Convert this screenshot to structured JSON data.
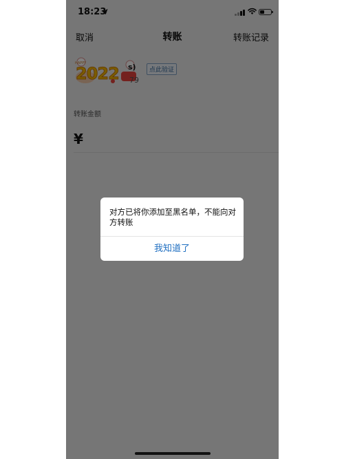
{
  "status_bar": {
    "time": "18:23"
  },
  "nav": {
    "cancel_label": "取消",
    "title": "转账",
    "records_label": "转账记录"
  },
  "recipient": {
    "name_suffix": "s)",
    "verify_label": "点此验证",
    "account_suffix": "79"
  },
  "amount": {
    "label": "转账金额",
    "currency_symbol": "¥"
  },
  "dialog": {
    "message": "对方已将你添加至黑名单，不能向对方转账",
    "confirm_label": "我知道了"
  },
  "avatar": {
    "sticker_text": "2022",
    "tag_text": "HAPPY"
  },
  "colors": {
    "link_blue": "#1f6fc1",
    "overlay": "rgba(0,0,0,0.5)",
    "page_bg": "#ededed"
  }
}
